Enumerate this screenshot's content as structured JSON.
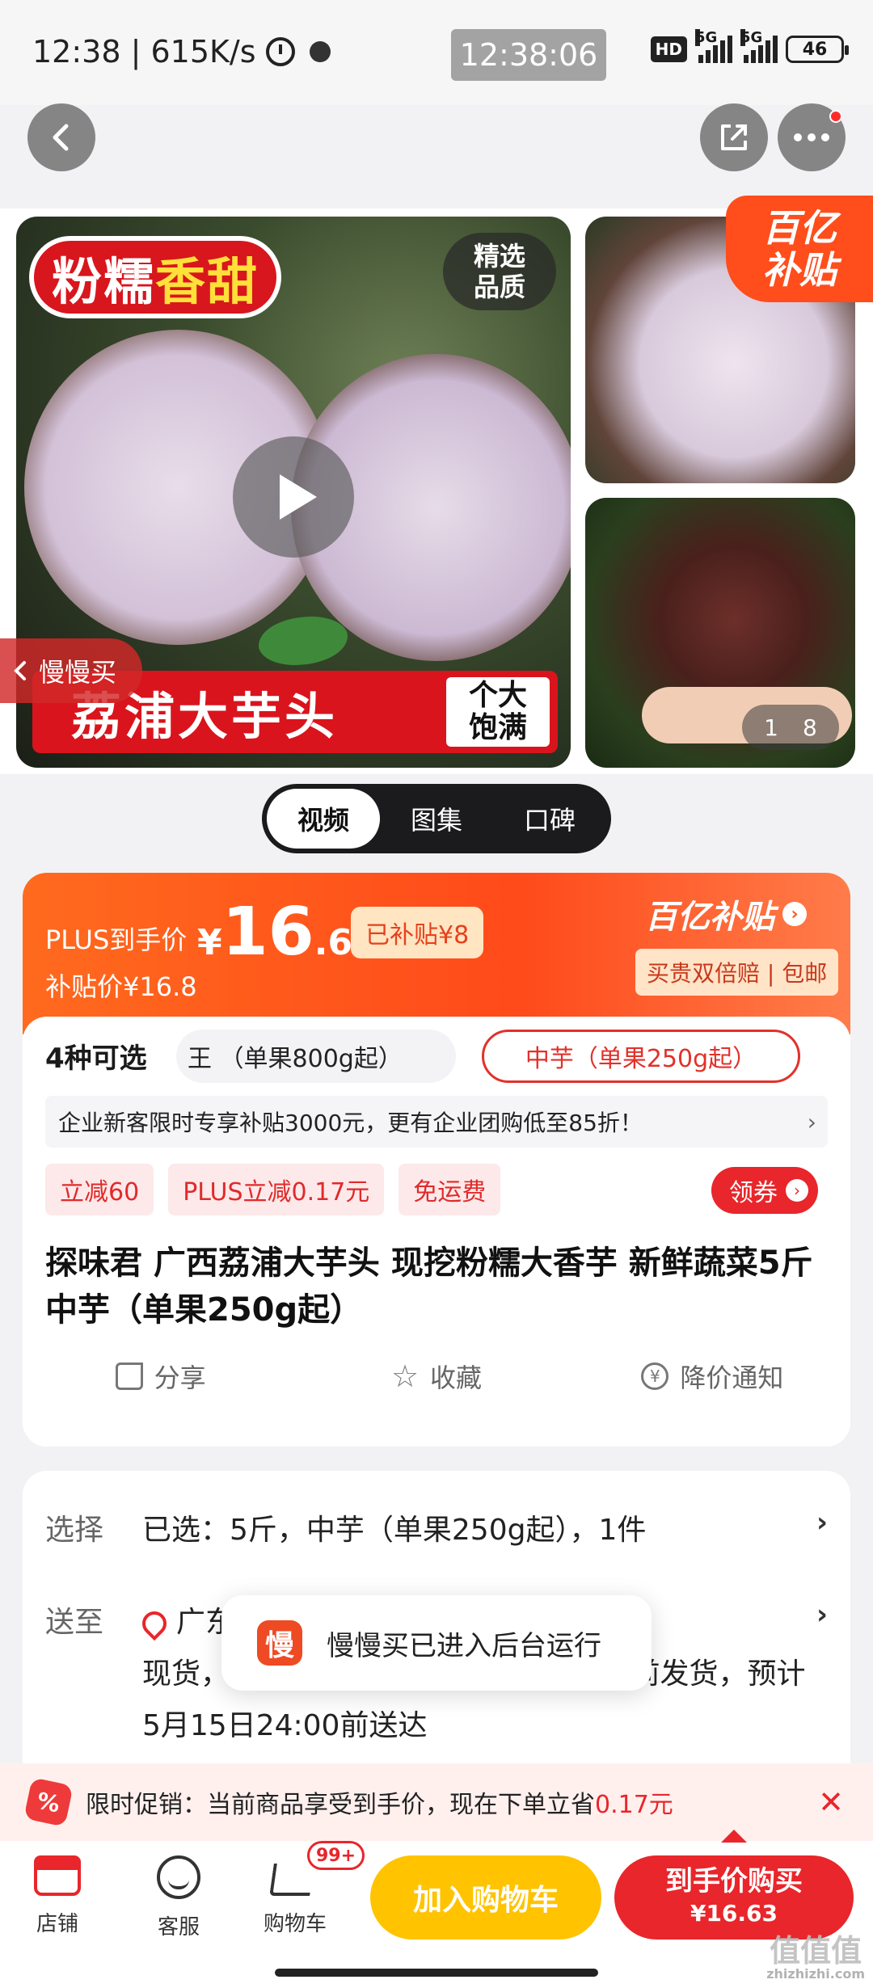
{
  "status_bar": {
    "time_speed": "12:38 | 615K/s",
    "clock": "12:38:06",
    "hd": "HD",
    "signal1": "5G",
    "signal2": "5G",
    "battery": "46"
  },
  "gallery": {
    "badge_left": "粉糯",
    "badge_right": "香甜",
    "quality_line1": "精选",
    "quality_line2": "品质",
    "product_name": "荔浦大芋头",
    "big_line1": "个大",
    "big_line2": "饱满",
    "slow_buy": "慢慢买",
    "subsidy_line1": "百亿",
    "subsidy_line2": "补贴",
    "counter_current": "1",
    "counter_total": "8"
  },
  "tabs": [
    {
      "label": "视频",
      "active": true
    },
    {
      "label": "图集",
      "active": false
    },
    {
      "label": "口碑",
      "active": false
    }
  ],
  "price": {
    "plus_label": "PLUS到手价",
    "currency": "¥",
    "int": "16",
    "dec": ".63",
    "subsidized": "已补贴¥8",
    "subsidy_price": "补贴价¥16.8",
    "logo": "百亿补贴",
    "guarantee": "买贵双倍赔 | 包邮"
  },
  "options": {
    "count_label": "4种可选",
    "option_prev": "王 （单果800g起）",
    "option_selected": "中芋（单果250g起）"
  },
  "promo_bar": "企业新客限时专享补贴3000元，更有企业团购低至85折！",
  "tags": [
    "立减60",
    "PLUS立减0.17元",
    "免运费"
  ],
  "coupon": "领券",
  "product_title": "探味君 广西荔浦大芋头 现挖粉糯大香芋 新鲜蔬菜5斤 中芋（单果250g起）",
  "actions": {
    "share": "分享",
    "favorite": "收藏",
    "price_alert": "降价通知"
  },
  "selection": {
    "label": "选择",
    "value": "已选：5斤，中芋（单果250g起），1件"
  },
  "delivery": {
    "label": "送至",
    "address": "广东",
    "text": "现货，现在下单，预计5月12日24:00前发货，预计5月15日24:00前送达"
  },
  "toast": {
    "icon": "慢",
    "text": "慢慢买已进入后台运行"
  },
  "limit_promo": {
    "prefix": "限时促销：当前商品享受到手价，现在下单立省",
    "amount": "0.17元"
  },
  "bottom_bar": {
    "shop": "店铺",
    "service": "客服",
    "cart": "购物车",
    "cart_badge": "99+",
    "add_cart": "加入购物车",
    "buy_line1": "到手价购买",
    "buy_line2": "¥16.63"
  },
  "watermark": {
    "main": "值值值",
    "sub": "zhizhizhi.com"
  },
  "colors": {
    "accent_red": "#e8262b",
    "orange": "#ff5a1e",
    "yellow": "#ffc300"
  }
}
